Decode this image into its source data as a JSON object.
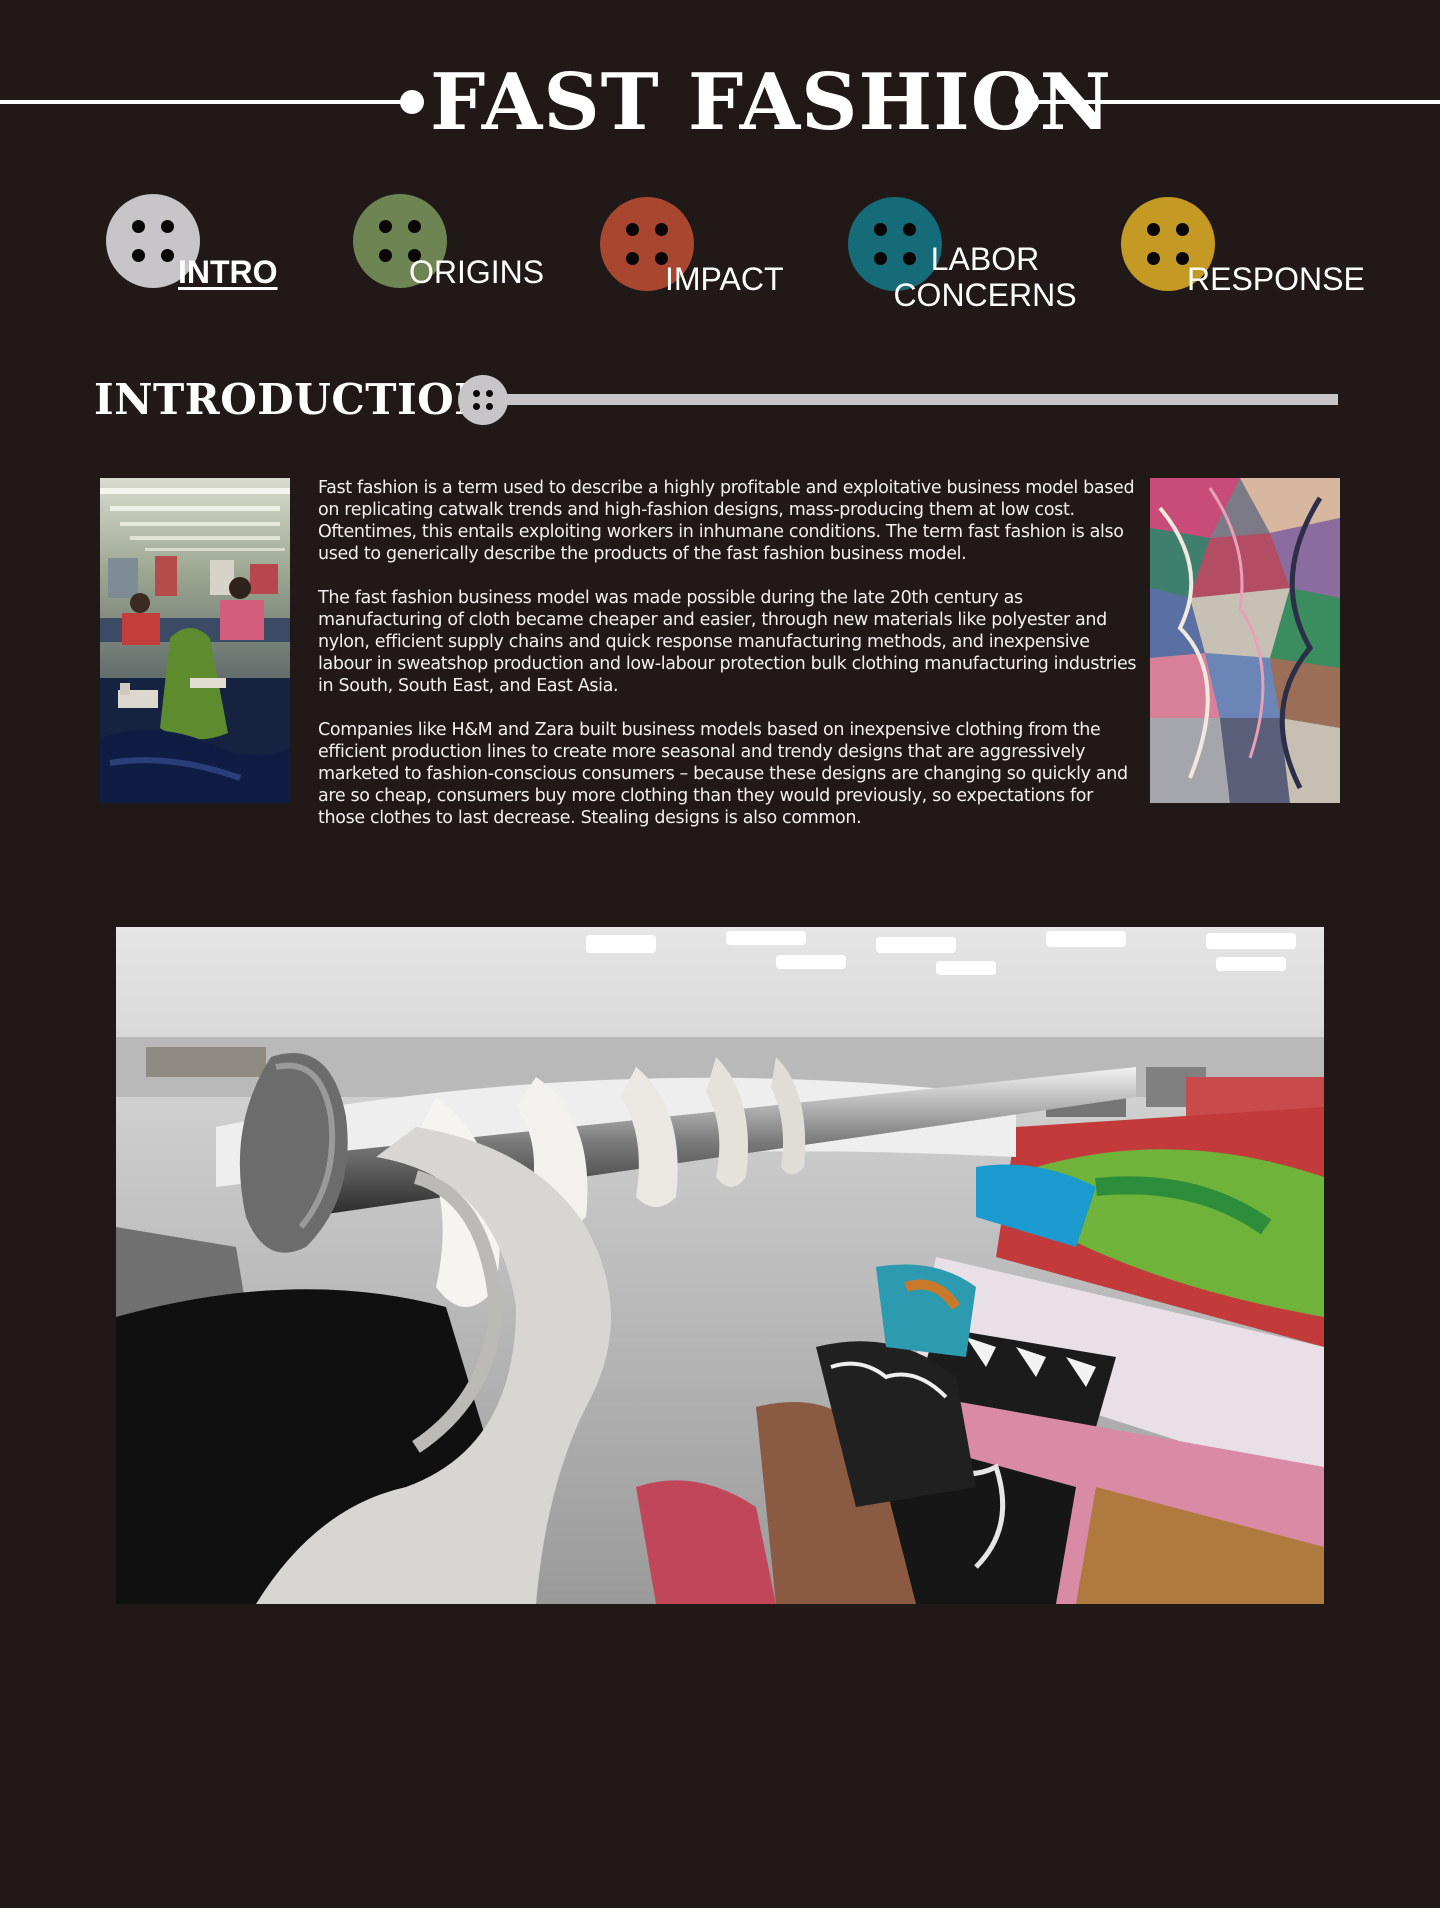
{
  "header": {
    "title": "FAST FASHION"
  },
  "nav": {
    "items": [
      {
        "label": "INTRO",
        "color": "#c7c5c7",
        "active": true
      },
      {
        "label": "ORIGINS",
        "color": "#6e8553"
      },
      {
        "label": "IMPACT",
        "color": "#a9462f"
      },
      {
        "label": "LABOR\nCONCERNS",
        "color": "#156b78"
      },
      {
        "label": "RESPONSE",
        "color": "#c49a25"
      }
    ]
  },
  "section": {
    "title": "INTRODUCTION",
    "accent_color": "#c7c5c7"
  },
  "content": {
    "paragraphs": [
      "Fast fashion is a term used to describe a highly profitable and exploitative business model based on replicating catwalk trends and high-fashion designs, mass-producing them at low cost. Oftentimes, this entails exploiting workers in inhumane conditions. The term fast fashion is also used to generically describe the products of the fast fashion business model.",
      "The fast fashion business model was made possible during the late 20th century as manufacturing of cloth became cheaper and easier, through new materials like polyester and nylon, efficient supply chains and quick response manufacturing methods, and inexpensive labour in sweatshop production and low-labour protection bulk clothing manufacturing industries in South, South East, and East Asia.",
      "Companies like H&M and Zara built business models based on inexpensive clothing from the efficient production lines to create more seasonal and trendy designs that are aggressively marketed to fashion-conscious consumers – because these designs are changing so quickly and are so cheap, consumers buy more clothing than they would previously, so expectations for those clothes to last decrease. Stealing designs is also common."
    ]
  },
  "theme": {
    "background": "#201918",
    "text": "#ffffff"
  }
}
